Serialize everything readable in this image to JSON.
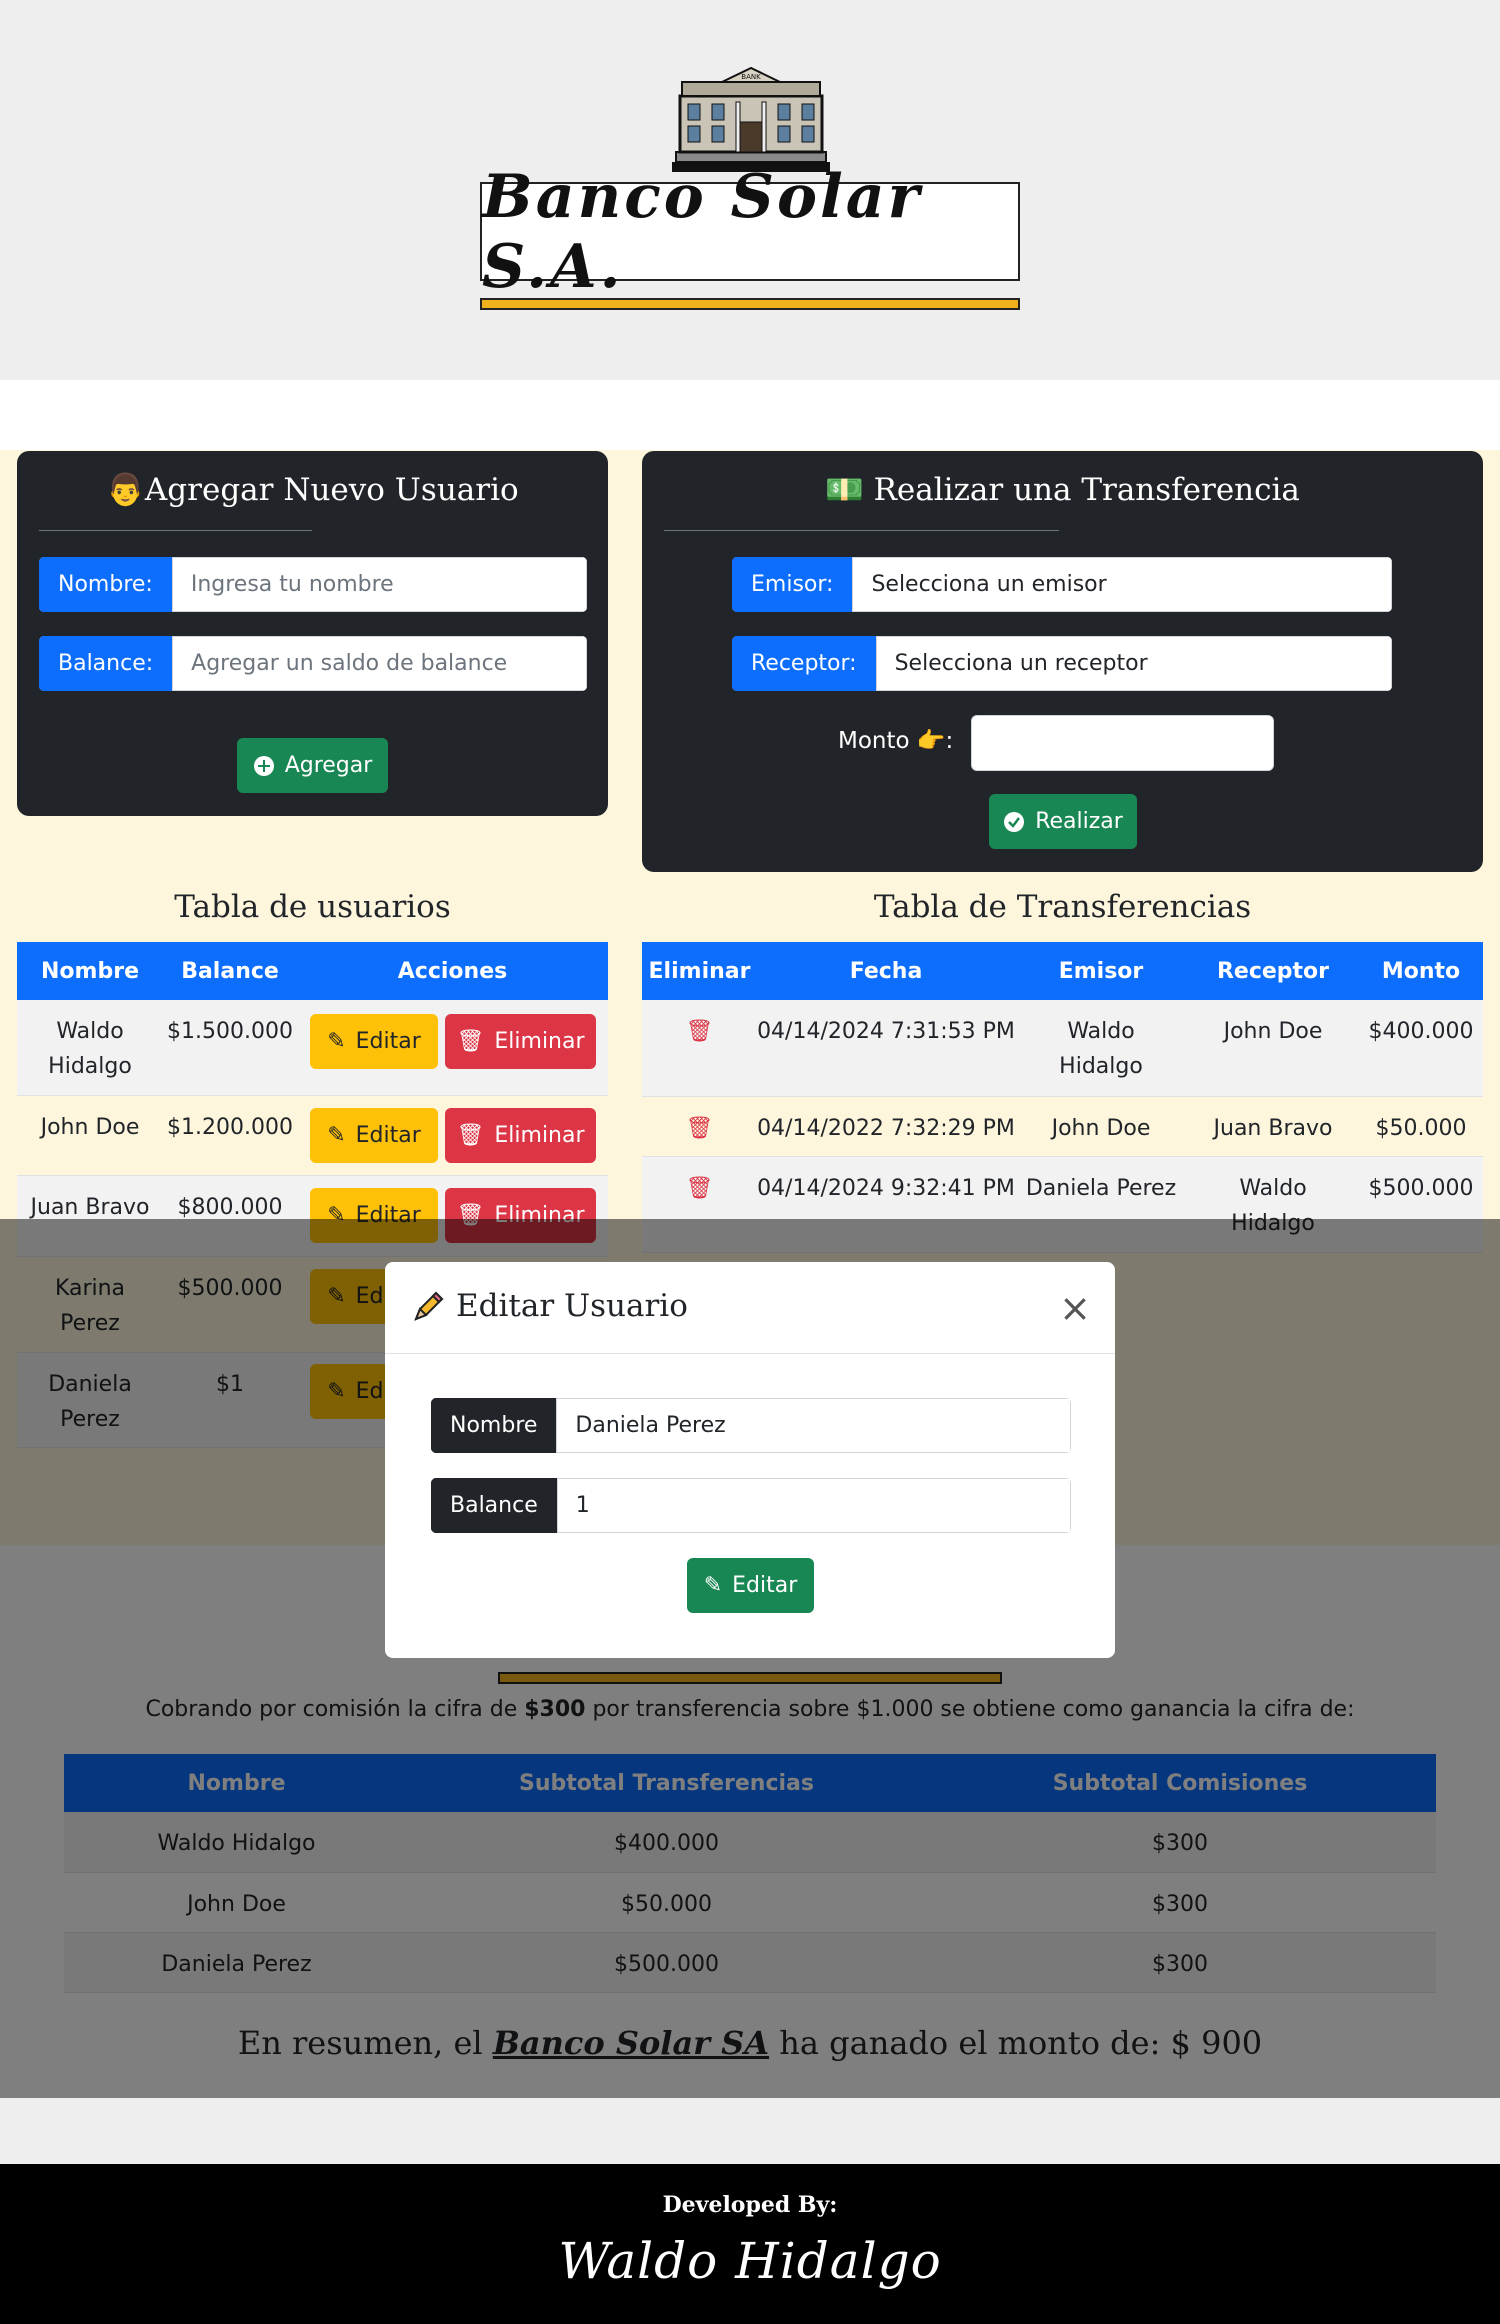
{
  "header": {
    "bank_label": "BANK",
    "logo_text": "Banco Solar S.A."
  },
  "add_user": {
    "title": "Agregar Nuevo Usuario",
    "name_label": "Nombre:",
    "name_placeholder": "Ingresa tu nombre",
    "balance_label": "Balance:",
    "balance_placeholder": "Agregar un saldo de balance",
    "button": "Agregar"
  },
  "transfer": {
    "title": "Realizar una Transferencia",
    "sender_label": "Emisor:",
    "sender_value": "Selecciona un emisor",
    "receiver_label": "Receptor:",
    "receiver_value": "Selecciona un receptor",
    "amount_label": "Monto",
    "button": "Realizar"
  },
  "users_table": {
    "title": "Tabla de usuarios",
    "headers": [
      "Nombre",
      "Balance",
      "Acciones"
    ],
    "edit_label": "Editar",
    "delete_label": "Eliminar",
    "rows": [
      {
        "name": "Waldo Hidalgo",
        "balance": "$1.500.000"
      },
      {
        "name": "John Doe",
        "balance": "$1.200.000"
      },
      {
        "name": "Juan Bravo",
        "balance": "$800.000"
      },
      {
        "name": "Karina Perez",
        "balance": "$500.000"
      },
      {
        "name": "Daniela Perez",
        "balance": "$1"
      }
    ]
  },
  "transfers_table": {
    "title": "Tabla de Transferencias",
    "headers": [
      "Eliminar",
      "Fecha",
      "Emisor",
      "Receptor",
      "Monto"
    ],
    "rows": [
      {
        "date": "04/14/2024 7:31:53 PM",
        "sender": "Waldo Hidalgo",
        "receiver": "John Doe",
        "amount": "$400.000"
      },
      {
        "date": "04/14/2022 7:32:29 PM",
        "sender": "John Doe",
        "receiver": "Juan Bravo",
        "amount": "$50.000"
      },
      {
        "date": "04/14/2024 9:32:41 PM",
        "sender": "Daniela Perez",
        "receiver": "Waldo Hidalgo",
        "amount": "$500.000"
      }
    ]
  },
  "summary": {
    "text_pre": "Cobrando por comisión la cifra de ",
    "fee": "$300",
    "text_post": " por transferencia sobre $1.000 se obtiene como ganancia la cifra de:",
    "headers": [
      "Nombre",
      "Subtotal Transferencias",
      "Subtotal Comisiones"
    ],
    "rows": [
      {
        "name": "Waldo Hidalgo",
        "transfers": "$400.000",
        "fees": "$300"
      },
      {
        "name": "John Doe",
        "transfers": "$50.000",
        "fees": "$300"
      },
      {
        "name": "Daniela Perez",
        "transfers": "$500.000",
        "fees": "$300"
      }
    ],
    "final_pre": "En resumen, el ",
    "final_bank": "Banco Solar SA",
    "final_post": " ha ganado el monto de: $ 900"
  },
  "modal": {
    "title": "Editar Usuario",
    "name_label": "Nombre",
    "name_value": "Daniela Perez",
    "balance_label": "Balance",
    "balance_value": "1",
    "button": "Editar"
  },
  "footer": {
    "label": "Developed By:",
    "signature": "Waldo Hidalgo"
  },
  "colors": {
    "primary": "#0d6efd",
    "success": "#198754",
    "warning": "#ffc107",
    "danger": "#dc3545",
    "dark": "#212529",
    "gold": "#f0b21c"
  }
}
